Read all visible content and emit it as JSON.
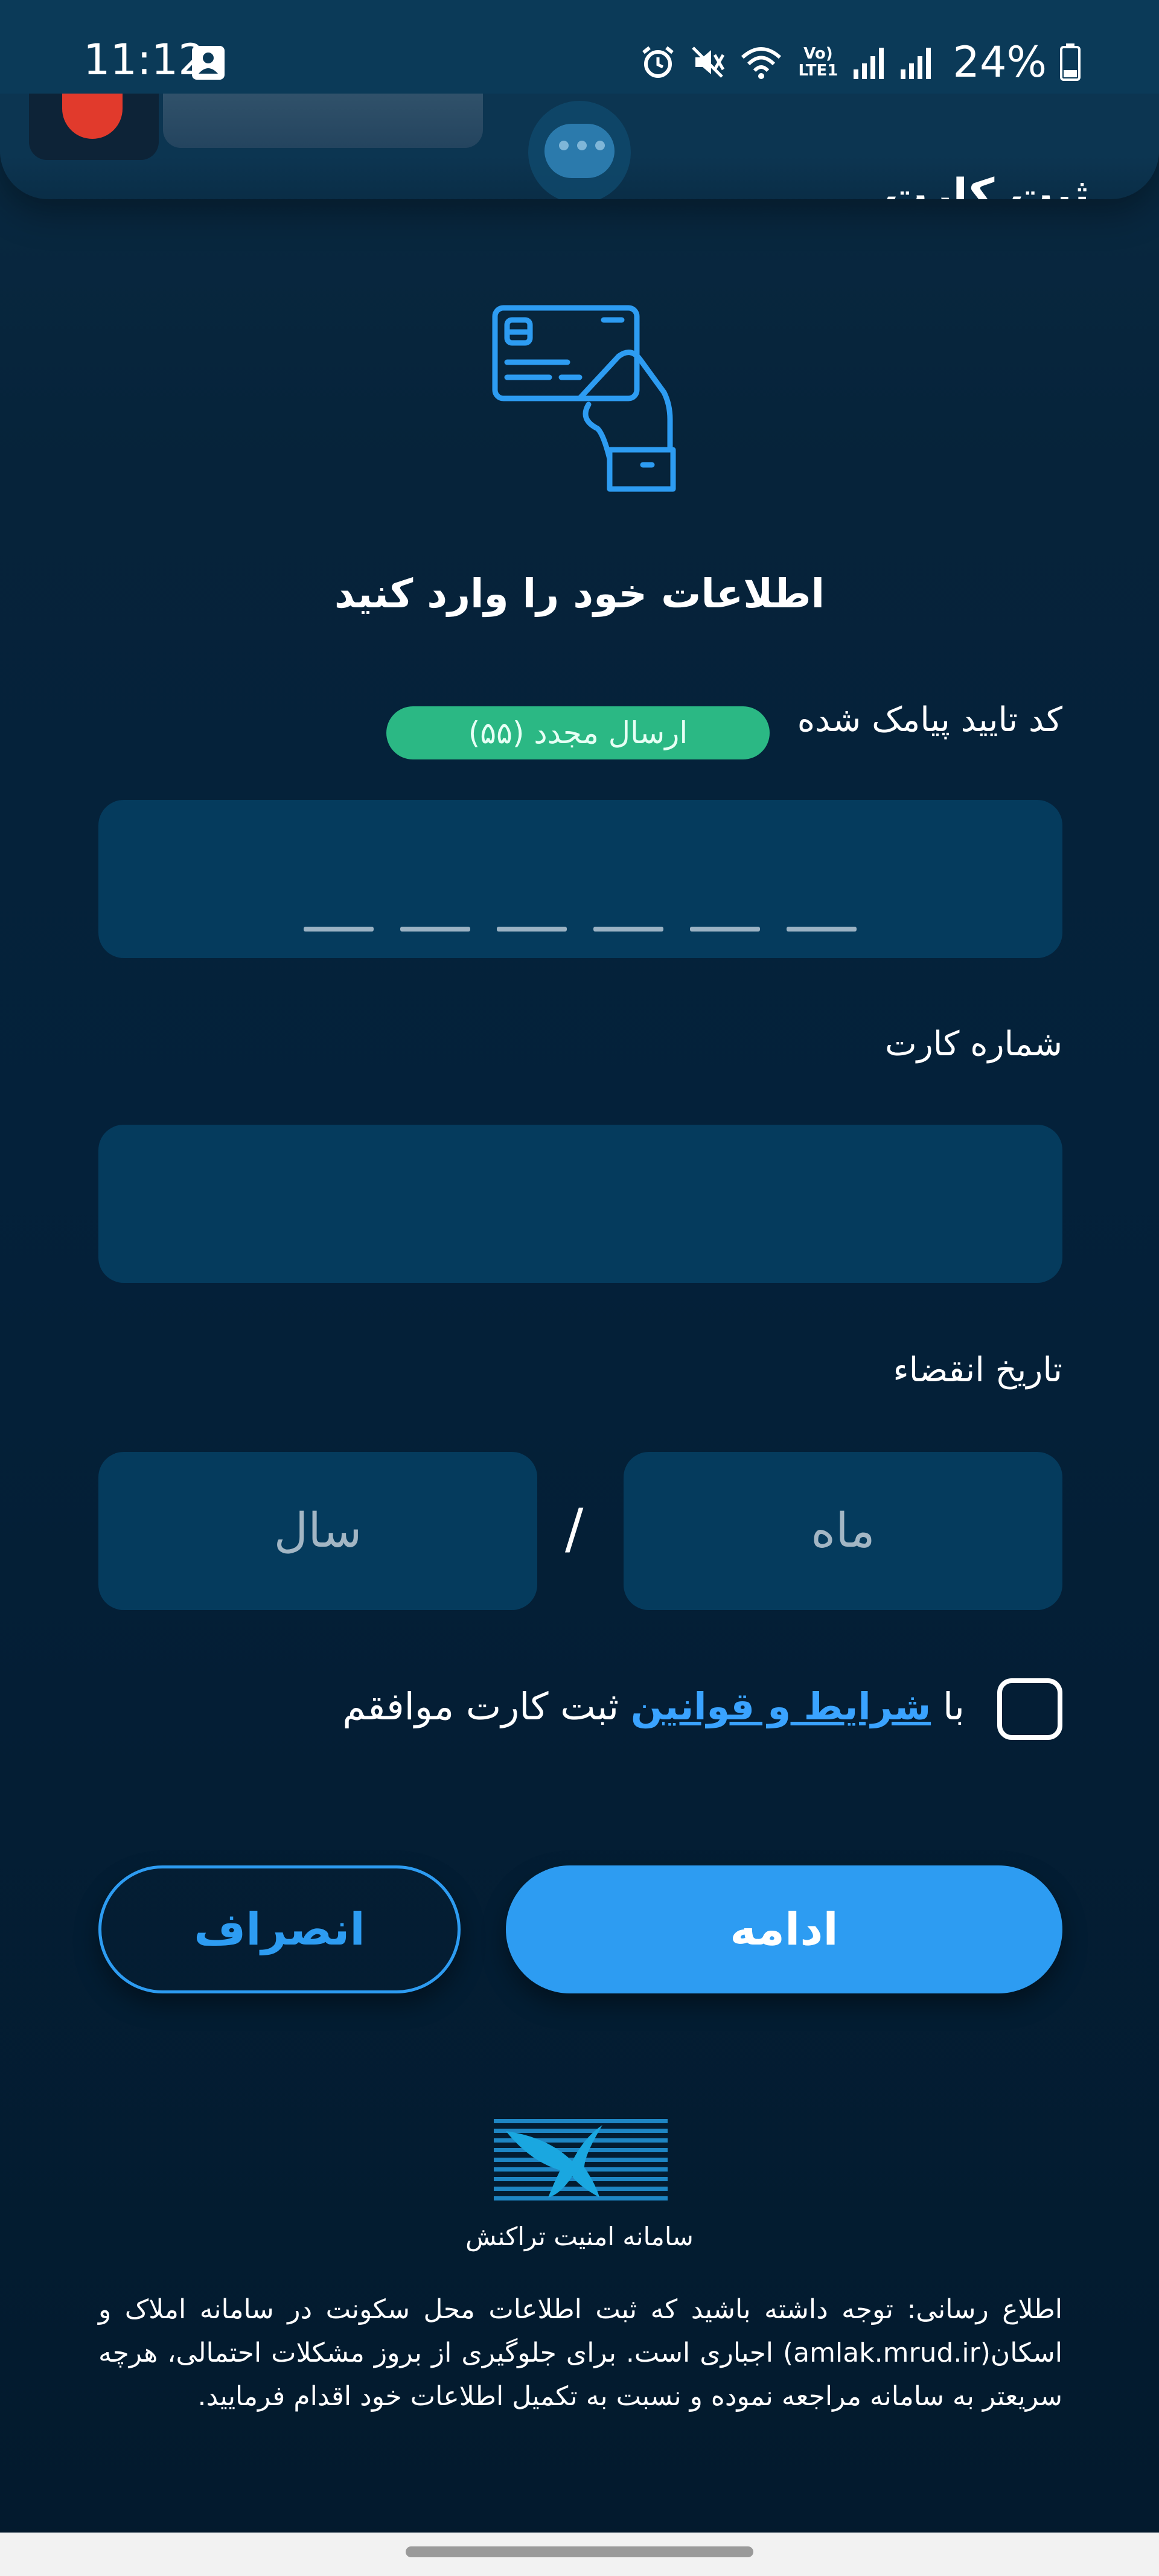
{
  "status_bar": {
    "time": "11:12",
    "battery": "24%",
    "network_label": "Vo) LTE1",
    "icons": [
      "notification-icon",
      "alarm-icon",
      "mute-icon",
      "wifi-icon",
      "signal-icon",
      "battery-icon"
    ]
  },
  "header": {
    "title": "ثبت کارت"
  },
  "form": {
    "heading": "اطلاعات خود را وارد کنید",
    "otp_label": "کد تایید پیامک شده",
    "resend_label": "ارسال مجدد (۵۵)",
    "otp_slots": 6,
    "card_number_label": "شماره کارت",
    "expiry_label": "تاریخ انقضاء",
    "month_placeholder": "ماه",
    "year_placeholder": "سال",
    "slash": "/"
  },
  "terms": {
    "prefix": "با",
    "link": "شرایط و قوانین",
    "suffix": "ثبت کارت موافقم",
    "checked": false
  },
  "buttons": {
    "continue": "ادامه",
    "cancel": "انصراف"
  },
  "footer": {
    "security_title": "سامانه امنیت تراکنش",
    "notice": "اطلاع رسانی: توجه داشته باشید که ثبت اطلاعات محل سکونت در سامانه املاک و اسکان(amlak.mrud.ir) اجباری است. برای جلوگیری از بروز مشکلات احتمالی، هرچه سریعتر به سامانه مراجعه نموده و نسبت به تکمیل اطلاعات خود اقدام فرمایید."
  },
  "colors": {
    "accent": "#2d9cf2",
    "badge": "#2bb884",
    "field": "#053b5d",
    "background": "#04213a"
  }
}
